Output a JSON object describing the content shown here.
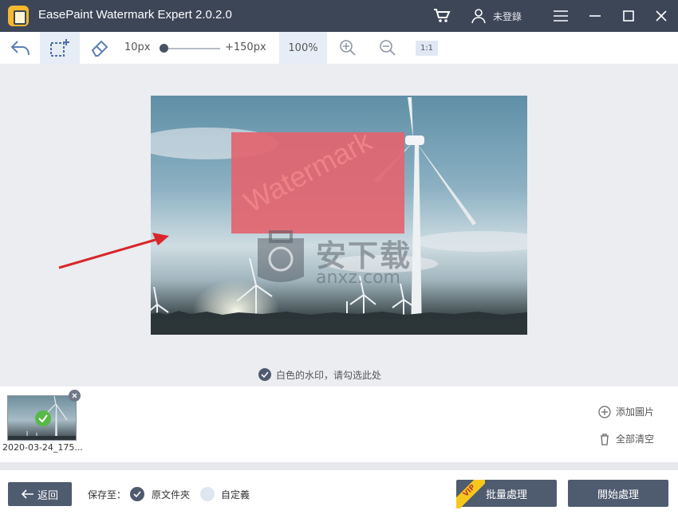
{
  "app": {
    "title": "EasePaint Watermark Expert  2.0.2.0",
    "login_label": "未登錄"
  },
  "toolbar": {
    "size_min": "10px",
    "size_max": "+150px",
    "zoom": "100%",
    "ratio_label": "1:1",
    "brush_size_level": 0
  },
  "canvas": {
    "watermark_text": "Watermark",
    "white_watermark_label": "白色的水印，请勾选此处",
    "site_name": "安下载",
    "site_url": "anxz.com"
  },
  "thumbnails": [
    {
      "name": "2020-03-24_175...",
      "selected": true
    }
  ],
  "actions": {
    "add_image": "添加圖片",
    "clear_all": "全部清空"
  },
  "bottom": {
    "back_label": "返回",
    "save_to_label": "保存至：",
    "option_original": "原文件夾",
    "option_custom": "自定義",
    "batch_label": "批量處理",
    "start_label": "開始處理",
    "vip_badge": "VIP"
  },
  "colors": {
    "titlebar": "#3d4657",
    "button_dark": "#4f5b6f",
    "watermark_fill": "#e26570",
    "check_green": "#57b947",
    "vip_yellow": "#f6c81d"
  }
}
